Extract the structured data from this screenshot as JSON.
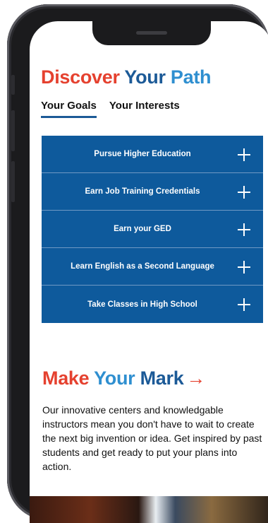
{
  "section1": {
    "title_part1": "Discover",
    "title_part2": "Your",
    "title_part3": "Path"
  },
  "tabs": [
    {
      "label": "Your Goals",
      "active": true
    },
    {
      "label": "Your Interests",
      "active": false
    }
  ],
  "accordion": [
    {
      "label": "Pursue Higher Education"
    },
    {
      "label": "Earn Job Training Credentials"
    },
    {
      "label": "Earn your GED"
    },
    {
      "label": "Learn English as a Second Language"
    },
    {
      "label": "Take Classes in High School"
    }
  ],
  "section2": {
    "title_part1": "Make",
    "title_part2": "Your",
    "title_part3": "Mark",
    "arrow": "→",
    "body": "Our innovative centers and knowledgable instructors mean you don't have to wait to create the next big invention or idea. Get inspired by past students and get ready to put your plans into action."
  },
  "colors": {
    "accent_red": "#e5412f",
    "brand_blue": "#1c5a97",
    "accordion_blue": "#0e5a9c",
    "light_blue": "#2f8fd0"
  },
  "icons": {
    "expand": "plus-icon",
    "arrow": "arrow-right-icon"
  }
}
